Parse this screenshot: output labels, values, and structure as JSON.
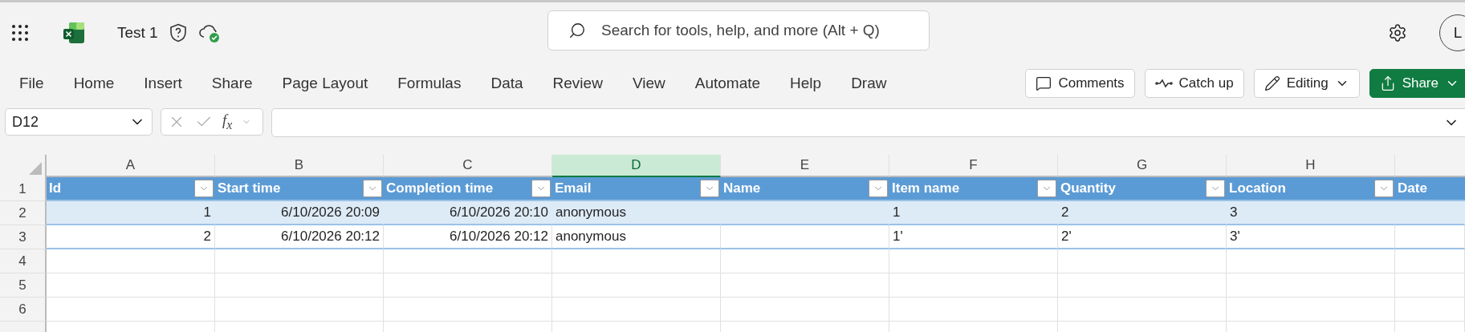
{
  "app_bar": {
    "title": "Test 1",
    "avatar": "L"
  },
  "search": {
    "placeholder": "Search for tools, help, and more (Alt + Q)"
  },
  "menu": [
    {
      "label": "File"
    },
    {
      "label": "Home"
    },
    {
      "label": "Insert"
    },
    {
      "label": "Share"
    },
    {
      "label": "Page Layout"
    },
    {
      "label": "Formulas"
    },
    {
      "label": "Data"
    },
    {
      "label": "Review"
    },
    {
      "label": "View"
    },
    {
      "label": "Automate"
    },
    {
      "label": "Help"
    },
    {
      "label": "Draw"
    }
  ],
  "actions": [
    {
      "label": "Comments",
      "kind": "comments"
    },
    {
      "label": "Catch up",
      "kind": "catchup"
    },
    {
      "label": "Editing",
      "kind": "editing"
    },
    {
      "label": "Share",
      "kind": "share"
    }
  ],
  "name_box": {
    "value": "D12"
  },
  "formula_bar": {
    "function_label": "f$_{x}$"
  },
  "grid": {
    "columns": [
      {
        "letter": "A",
        "selected": false
      },
      {
        "letter": "B",
        "selected": false
      },
      {
        "letter": "C",
        "selected": false
      },
      {
        "letter": "D",
        "selected": true
      },
      {
        "letter": "E",
        "selected": false
      },
      {
        "letter": "F",
        "selected": false
      },
      {
        "letter": "G",
        "selected": false
      },
      {
        "letter": "H",
        "selected": false
      }
    ],
    "row_numbers": [
      "1",
      "2",
      "3",
      "4",
      "5",
      "6"
    ],
    "table": {
      "headers": [
        {
          "label": "Id",
          "kind": "number",
          "filter": true
        },
        {
          "label": "Start time",
          "kind": "number",
          "filter": true
        },
        {
          "label": "Completion time",
          "kind": "number",
          "filter": true
        },
        {
          "label": "Email",
          "kind": "text",
          "filter": true
        },
        {
          "label": "Name",
          "kind": "text",
          "filter": true
        },
        {
          "label": "Item name",
          "kind": "text",
          "filter": true
        },
        {
          "label": "Quantity",
          "kind": "text",
          "filter": true
        },
        {
          "label": "Location",
          "kind": "text",
          "filter": true
        },
        {
          "label": "Date",
          "kind": "text",
          "filter": false
        }
      ],
      "rows": [
        {
          "shaded": true,
          "cells": [
            "1",
            "6/10/2026 20:09",
            "6/10/2026 20:10",
            "anonymous",
            "",
            "1",
            "2",
            "3",
            ""
          ]
        },
        {
          "shaded": false,
          "cells": [
            "2",
            "6/10/2026 20:12",
            "6/10/2026 20:12",
            "anonymous",
            "",
            "1'",
            "2'",
            "3'",
            ""
          ]
        }
      ]
    }
  }
}
